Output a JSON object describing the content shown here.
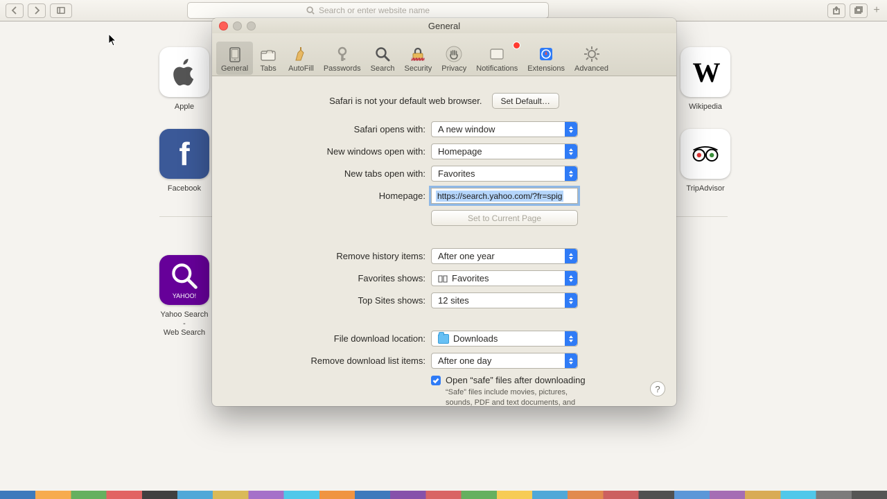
{
  "browser": {
    "address_placeholder": "Search or enter website name"
  },
  "bookmarks": {
    "apple": "Apple",
    "facebook": "Facebook",
    "yahoo": "Yahoo Search -\nWeb Search",
    "wikipedia": "Wikipedia",
    "tripadvisor": "TripAdvisor"
  },
  "window": {
    "title": "General"
  },
  "tabs": {
    "general": "General",
    "tabs": "Tabs",
    "autofill": "AutoFill",
    "passwords": "Passwords",
    "search": "Search",
    "security": "Security",
    "privacy": "Privacy",
    "notifications": "Notifications",
    "extensions": "Extensions",
    "advanced": "Advanced"
  },
  "body": {
    "default_msg": "Safari is not your default web browser.",
    "set_default_btn": "Set Default…",
    "opens_with_label": "Safari opens with:",
    "opens_with_value": "A new window",
    "new_windows_label": "New windows open with:",
    "new_windows_value": "Homepage",
    "new_tabs_label": "New tabs open with:",
    "new_tabs_value": "Favorites",
    "homepage_label": "Homepage:",
    "homepage_value": "https://search.yahoo.com/?fr=spig",
    "set_current_btn": "Set to Current Page",
    "remove_history_label": "Remove history items:",
    "remove_history_value": "After one year",
    "favorites_shows_label": "Favorites shows:",
    "favorites_shows_value": "Favorites",
    "topsites_label": "Top Sites shows:",
    "topsites_value": "12 sites",
    "download_loc_label": "File download location:",
    "download_loc_value": "Downloads",
    "remove_dl_label": "Remove download list items:",
    "remove_dl_value": "After one day",
    "safe_open_label": "Open “safe” files after downloading",
    "safe_hint": "“Safe” files include movies, pictures, sounds, PDF and text documents, and archives.",
    "help": "?"
  }
}
